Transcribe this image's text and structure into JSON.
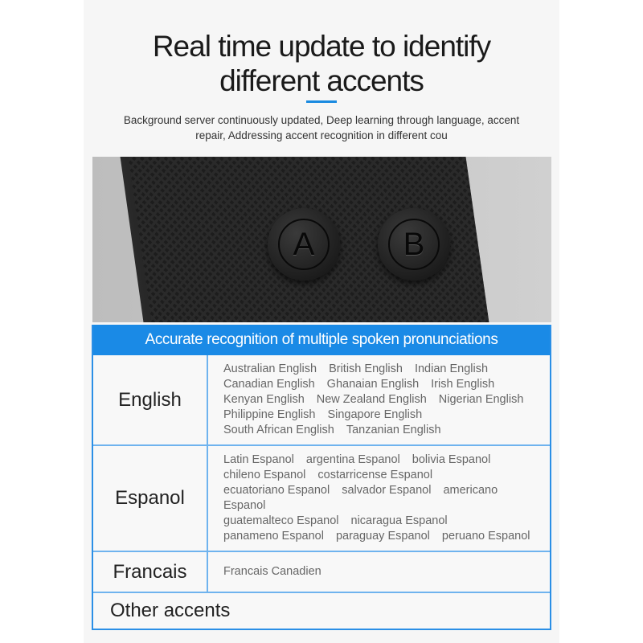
{
  "header": {
    "title_line1": "Real time update to identify",
    "title_line2": "different accents",
    "subtitle_line1": "Background server continuously updated, Deep learning through language, accent",
    "subtitle_line2": "repair, Addressing accent recognition in different cou",
    "accent_color": "#1a8ae6"
  },
  "photo": {
    "button_a": "A",
    "button_b": "B"
  },
  "table": {
    "heading": "Accurate recognition of multiple spoken pronunciations",
    "rows": [
      {
        "language": "English",
        "lines": [
          [
            "Australian English",
            "British English",
            "Indian English"
          ],
          [
            "Canadian English",
            "Ghanaian English",
            "Irish English"
          ],
          [
            "Kenyan English",
            "New Zealand English",
            "Nigerian English"
          ],
          [
            "Philippine English",
            "Singapore English"
          ],
          [
            "South African English",
            "Tanzanian English"
          ]
        ]
      },
      {
        "language": "Espanol",
        "lines": [
          [
            "Latin Espanol",
            "argentina Espanol",
            "bolivia Espanol"
          ],
          [
            "chileno Espanol",
            "costarricense Espanol"
          ],
          [
            "ecuatoriano Espanol",
            "salvador Espanol",
            "americano Espanol"
          ],
          [
            "guatemalteco Espanol",
            "nicaragua Espanol"
          ],
          [
            "panameno Espanol",
            "paraguay Espanol",
            "peruano Espanol"
          ]
        ]
      },
      {
        "language": "Francais",
        "lines": [
          [
            "Francais Canadien"
          ]
        ]
      }
    ],
    "other": "Other accents"
  }
}
